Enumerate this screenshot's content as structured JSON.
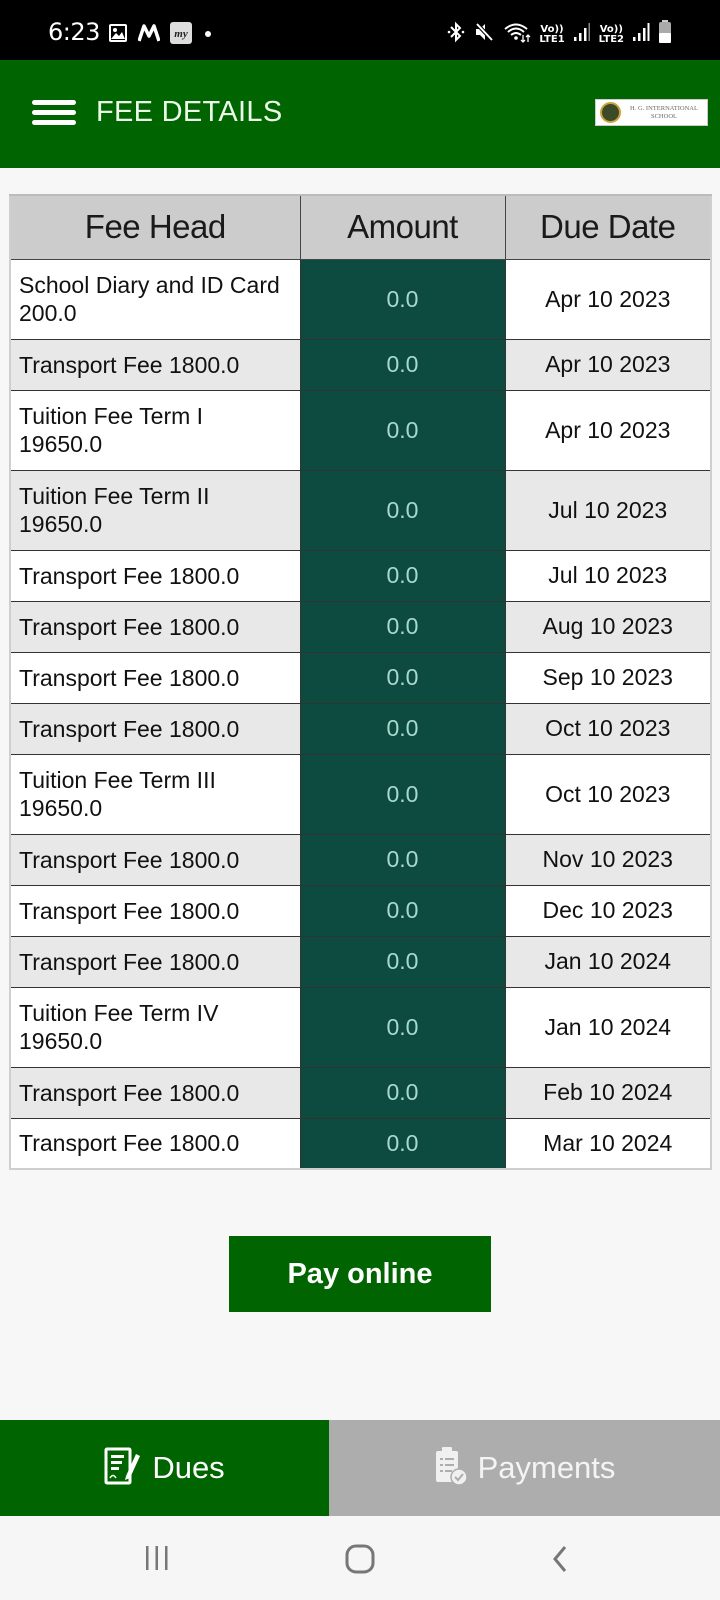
{
  "status_bar": {
    "time": "6:23",
    "left_icons": [
      "gallery-icon",
      "m-app-icon",
      "makemytrip-icon",
      "notification-dot"
    ],
    "right_icons": [
      "bluetooth-icon",
      "mute-icon",
      "wifi-icon",
      "lte1-signal-icon",
      "lte2-signal-icon",
      "battery-icon"
    ],
    "lte1_label": "LTE1",
    "lte2_label": "LTE2",
    "volte_label": "Vo))"
  },
  "app_bar": {
    "title": "FEE DETAILS",
    "logo_text_line1": "H. G. INTERNATIONAL",
    "logo_text_line2": "SCHOOL"
  },
  "table": {
    "headers": [
      "Fee Head",
      "Amount",
      "Due Date"
    ],
    "rows": [
      {
        "fee_head": "School Diary and ID Card 200.0",
        "amount": "0.0",
        "due_date": "Apr 10 2023"
      },
      {
        "fee_head": "Transport Fee 1800.0",
        "amount": "0.0",
        "due_date": "Apr 10 2023"
      },
      {
        "fee_head": "Tuition Fee Term I 19650.0",
        "amount": "0.0",
        "due_date": "Apr 10 2023"
      },
      {
        "fee_head": "Tuition Fee Term II 19650.0",
        "amount": "0.0",
        "due_date": "Jul 10 2023"
      },
      {
        "fee_head": "Transport Fee 1800.0",
        "amount": "0.0",
        "due_date": "Jul 10 2023"
      },
      {
        "fee_head": "Transport Fee 1800.0",
        "amount": "0.0",
        "due_date": "Aug 10 2023"
      },
      {
        "fee_head": "Transport Fee 1800.0",
        "amount": "0.0",
        "due_date": "Sep 10 2023"
      },
      {
        "fee_head": "Transport Fee 1800.0",
        "amount": "0.0",
        "due_date": "Oct 10 2023"
      },
      {
        "fee_head": "Tuition Fee Term III 19650.0",
        "amount": "0.0",
        "due_date": "Oct 10 2023"
      },
      {
        "fee_head": "Transport Fee 1800.0",
        "amount": "0.0",
        "due_date": "Nov 10 2023"
      },
      {
        "fee_head": "Transport Fee 1800.0",
        "amount": "0.0",
        "due_date": "Dec 10 2023"
      },
      {
        "fee_head": "Transport Fee 1800.0",
        "amount": "0.0",
        "due_date": "Jan 10 2024"
      },
      {
        "fee_head": "Tuition Fee Term IV 19650.0",
        "amount": "0.0",
        "due_date": "Jan 10 2024"
      },
      {
        "fee_head": "Transport Fee 1800.0",
        "amount": "0.0",
        "due_date": "Feb 10 2024"
      },
      {
        "fee_head": "Transport Fee 1800.0",
        "amount": "0.0",
        "due_date": "Mar 10 2024"
      }
    ]
  },
  "pay_button": {
    "label": "Pay online"
  },
  "bottom_nav": {
    "tabs": [
      {
        "label": "Dues",
        "icon": "dues-icon",
        "active": true
      },
      {
        "label": "Payments",
        "icon": "payments-icon",
        "active": false
      }
    ]
  },
  "colors": {
    "primary_green": "#006400",
    "amount_cell_bg": "#0d4a40",
    "amount_text": "#a8d9cc",
    "inactive_tab": "#adadad",
    "header_bg": "#cccccc"
  }
}
